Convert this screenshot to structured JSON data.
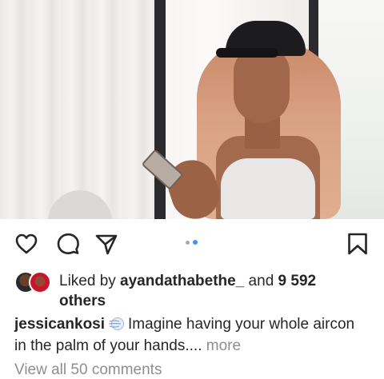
{
  "post": {
    "media": {
      "description_icon": "video-frame"
    },
    "actions": {
      "like_icon": "heart-outline-icon",
      "comment_icon": "comment-bubble-icon",
      "share_icon": "paper-plane-icon",
      "save_icon": "bookmark-outline-icon",
      "carousel_total": 2,
      "carousel_active": 2,
      "accent_color": "#3897f0"
    },
    "likes": {
      "prefix": "Liked by ",
      "user": "ayandathabethe_",
      "middle": " and ",
      "count": "9 592",
      "suffix": "others"
    },
    "caption": {
      "username": "jessicankosi",
      "emoji": "wind-face-emoji",
      "text_line1": "Imagine having your whole aircon",
      "text_line2": "in the palm of your hands....",
      "more": " more"
    },
    "comments_link": "View all 50 comments"
  }
}
